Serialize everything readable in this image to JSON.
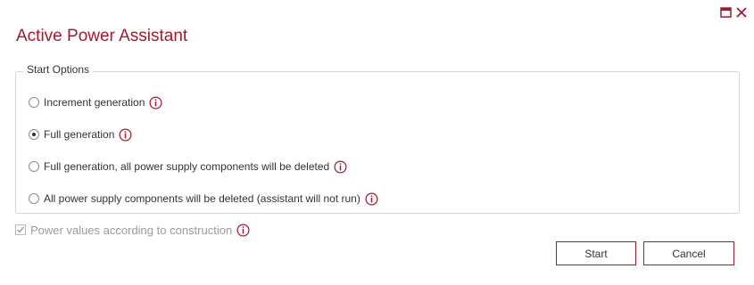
{
  "dialog": {
    "title": "Active Power Assistant",
    "accent_color": "#a3192e"
  },
  "window_controls": {
    "maximize_icon": "maximize-icon",
    "close_icon": "close-icon"
  },
  "start_options": {
    "legend": "Start Options",
    "options": [
      {
        "label": "Increment generation",
        "selected": false
      },
      {
        "label": "Full generation",
        "selected": true
      },
      {
        "label": "Full generation, all power supply components will be deleted",
        "selected": false
      },
      {
        "label": "All power supply components will be deleted (assistant will not run)",
        "selected": false
      }
    ]
  },
  "power_values": {
    "label": "Power values according to construction",
    "checked": true,
    "disabled": true
  },
  "buttons": {
    "start_label": "Start",
    "cancel_label": "Cancel"
  }
}
